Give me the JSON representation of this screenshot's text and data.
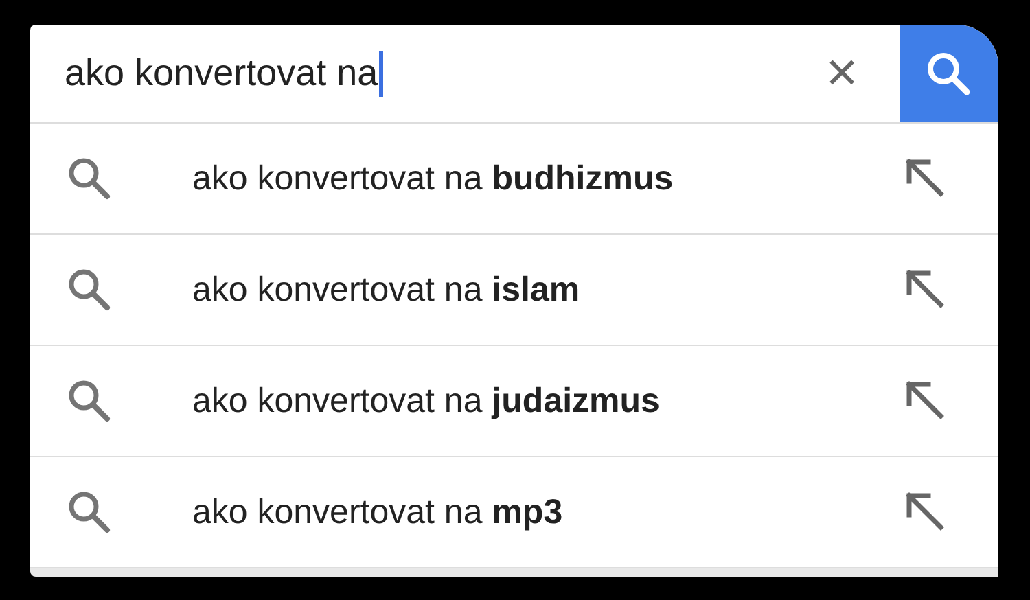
{
  "search": {
    "value": "ako konvertovat na",
    "clear": "×"
  },
  "suggestions": [
    {
      "text": "ako konvertovat na **budhizmus**"
    },
    {
      "text": "ako konvertovat na **islam**"
    },
    {
      "text": "ako konvertovat na **judaizmus**"
    },
    {
      "text": "ako konvertovat na **mp3**"
    }
  ]
}
